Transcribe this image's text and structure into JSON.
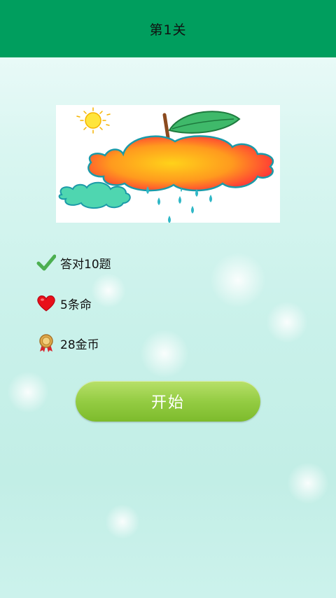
{
  "header": {
    "title": "第1关"
  },
  "requirements": [
    {
      "icon": "checkmark-icon",
      "label": "答对10题"
    },
    {
      "icon": "heart-icon",
      "label": "5条命"
    },
    {
      "icon": "medal-icon",
      "label": "28金币"
    }
  ],
  "start_button": {
    "label": "开始"
  },
  "colors": {
    "header_bg": "#009e5e",
    "button_green": "#94cc43",
    "check_green": "#4caf50",
    "heart_red": "#e8101a"
  }
}
